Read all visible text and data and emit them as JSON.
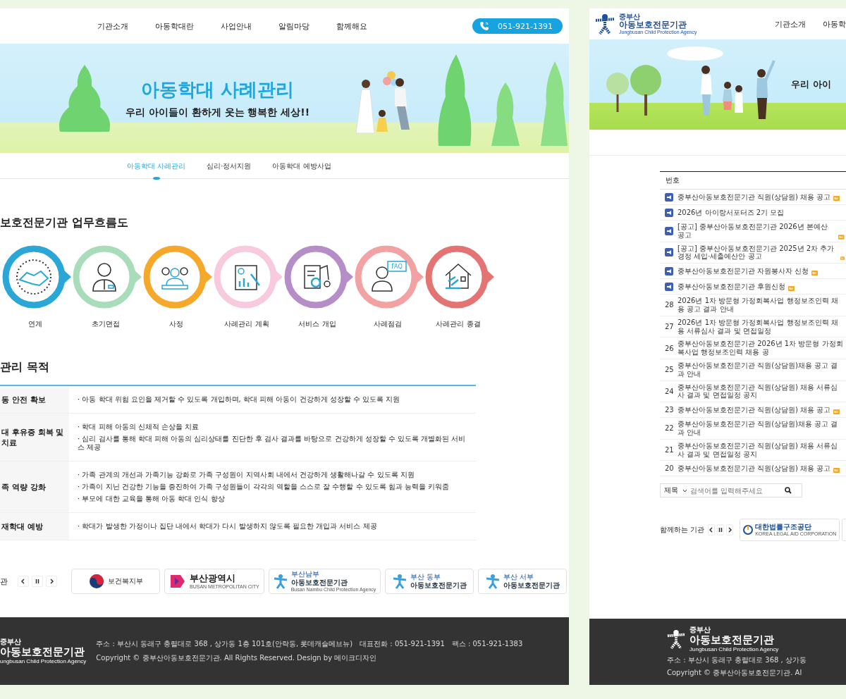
{
  "left_page": {
    "nav": [
      "기관소개",
      "아동학대란",
      "사업안내",
      "알림마당",
      "함께해요"
    ],
    "phone": "051-921-1391",
    "banner": {
      "title": "아동학대 사례관리",
      "subtitle": "우리 아이들이 환하게 웃는 행복한 세상!!"
    },
    "sub_tabs": [
      {
        "label": "아동학대 사례관리",
        "selected": true
      },
      {
        "label": "심리·정서지원",
        "selected": false
      },
      {
        "label": "아동학대 예방사업",
        "selected": false
      }
    ],
    "flow": {
      "title": "보호전문기관 업무흐름도",
      "steps": [
        {
          "label": "연계",
          "color": "#2aa7d6"
        },
        {
          "label": "초기면접",
          "color": "#a9dcb9"
        },
        {
          "label": "사정",
          "color": "#f5a82a"
        },
        {
          "label": "사례관리 계획",
          "color": "#f8cade"
        },
        {
          "label": "서비스 개입",
          "color": "#b58ec8"
        },
        {
          "label": "사례점검",
          "color": "#f2a2a2",
          "badge": "FAQ"
        },
        {
          "label": "사례관리 종결",
          "color": "#e47474"
        }
      ]
    },
    "purpose": {
      "title": "관리 목적",
      "rows": [
        {
          "heading": "동 안전 확보",
          "items": [
            "· 아동 학대 위험 요인을 제거할 수 있도록 개입하며, 학대 피해 아동이 건강하게 성장할 수 있도록 지원"
          ]
        },
        {
          "heading": "대 후유증 회복 및 치료",
          "items": [
            "· 학대 피해 아동의 신체적 손상을 치료",
            "· 심리 검사를 통해 학대 피해 아동의 심리상태를 진단한 후 검사 결과를 바탕으로 건강하게 성장할 수 있도록 개별화된 서비스 제공"
          ]
        },
        {
          "heading": "족 역량 강화",
          "items": [
            "· 가족 관계의 개선과 가족기능 강화로 가족 구성원이 지역사회 내에서 건강하게 생활해나갈 수 있도록 지원",
            "· 가족이 지닌 건강한 기능을 증진하여 가족 구성원들이 각각의 역할을 스스로 잘 수행할 수 있도록 힘과 능력을 키워줌",
            "· 부모에 대한 교육을 통해 아동 학대 인식 향상"
          ]
        },
        {
          "heading": "재학대 예방",
          "items": [
            "· 학대가 발생한 가정이나 집단 내에서 학대가 다시 발생하지 않도록 필요한 개입과 서비스 제공"
          ]
        }
      ]
    },
    "partners": {
      "title": "관",
      "logos": [
        {
          "kind": "ministry",
          "name": "보건복지부"
        },
        {
          "kind": "city",
          "name": "부산광역시",
          "subtitle": "BUSAN METROPOLITAN CITY"
        },
        {
          "kind": "agency",
          "region": "부산남부",
          "name": "아동보호전문기관",
          "subtitle": "Busan Nambu Child Protection Agency"
        },
        {
          "kind": "agency",
          "region": "부산 동부",
          "name": "아동보호전문기관"
        },
        {
          "kind": "agency",
          "region": "부산 서부",
          "name": "아동보호전문기관"
        }
      ]
    },
    "footer": {
      "logo_top": "중부산",
      "logo_main": "아동보호전문기관",
      "logo_sub": "ungbusan Child Protection Agency",
      "address": "주소 : 부산시 동래구 충렬대로 368 , 상가동 1층 101호(안락동, 롯데캐슬메브뉴)",
      "phone": "대표전화 : 051-921-1391",
      "fax": "팩스 : 051-921-1383",
      "copyright": "Copyright © 중부산아동보호전문기관. All Rights Reserved. Design by 메이크디자인"
    }
  },
  "right_page": {
    "logo": {
      "top": "중부산",
      "main": "아동보호전문기관",
      "sub": "Jungbusan Child Protection Agency"
    },
    "nav": [
      "기관소개",
      "아동학"
    ],
    "banner_text": "우리 아이",
    "list": {
      "column": "번호",
      "rows": [
        {
          "kind": "notice",
          "title": "중부산아동보호전문기관 직원(상담원) 채용 공고",
          "new": true
        },
        {
          "kind": "notice",
          "title": "2026년 아이랑서포터즈 2기 모집",
          "new": false
        },
        {
          "kind": "notice",
          "title": "[공고] 중부산아동보호전문기관 2026년 본예산 공고",
          "new": true
        },
        {
          "kind": "notice",
          "title": "[공고] 중부산아동보호전문기관 2025년 2차 추가경정 세입·세출예산안 공고",
          "new": true
        },
        {
          "kind": "notice",
          "title": "중부산아동보호전문기관 자원봉사자 신청",
          "new": true
        },
        {
          "kind": "notice",
          "title": "중부산아동보호전문기관 후원신청",
          "new": true
        },
        {
          "kind": "post",
          "number": "28",
          "title": "2026년 1차 방문형 가정회복사업 행정보조인력 채용 공고 결과 안내",
          "new": false
        },
        {
          "kind": "post",
          "number": "27",
          "title": "2026년 1차 방문형 가정회복사업 행정보조인력 채용 서류심사 결과 및 면접일정",
          "new": false
        },
        {
          "kind": "post",
          "number": "26",
          "title": "중부산아동보호전문기관 2026년 1차 방문형 가정회복사업 행정보조인력 채용 공",
          "new": false
        },
        {
          "kind": "post",
          "number": "25",
          "title": "중부산아동보호전문기관 직원(상담원)채용 공고 결과 안내",
          "new": false
        },
        {
          "kind": "post",
          "number": "24",
          "title": "중부산아동보호전문기관 직원(상담원) 채용 서류심사 결과 및 면접일정 공지",
          "new": false
        },
        {
          "kind": "post",
          "number": "23",
          "title": "중부산아동보호전문기관 직원(상담원) 채용 공고",
          "new": true
        },
        {
          "kind": "post",
          "number": "22",
          "title": "중부산아동보호전문기관 직원(상담원)채용 공고 결과 안내",
          "new": false
        },
        {
          "kind": "post",
          "number": "21",
          "title": "중부산아동보호전문기관 직원(상담원) 채용 서류심사 결과 및 면접일정 공지",
          "new": false
        },
        {
          "kind": "post",
          "number": "20",
          "title": "중부산아동보호전문기관 직원(상담원) 채용 공고",
          "new": true
        }
      ]
    },
    "search": {
      "select": "제목",
      "placeholder": "검색어를 입력해주세요"
    },
    "partners": {
      "title": "함께하는 기관",
      "logo": {
        "name": "대한법률구조공단",
        "subtitle": "KOREA LEGAL AID CORPORATION"
      }
    },
    "footer": {
      "logo_top": "중부산",
      "logo_main": "아동보호전문기관",
      "logo_sub": "Jungbusan Child Protection Agency",
      "address": "주소 : 부산시 동래구 충렬대로 368 , 상가동",
      "copyright": "Copyright © 중부산아동보호전문기관. Al"
    }
  }
}
